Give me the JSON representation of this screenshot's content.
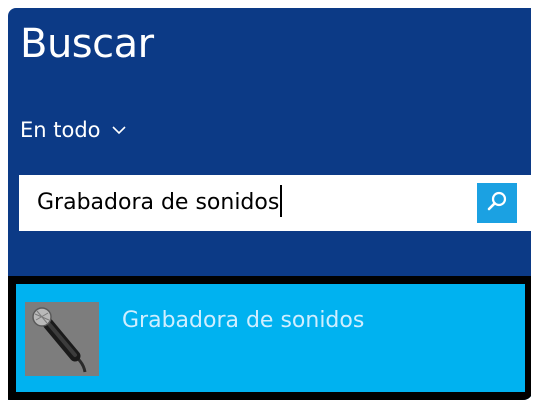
{
  "panel": {
    "title": "Buscar",
    "background_color": "#0c3a86"
  },
  "scope_selector": {
    "label": "En todo",
    "icon": "chevron-down-icon"
  },
  "search": {
    "value": "Grabadora de sonidos",
    "button_icon": "search-icon",
    "button_color": "#1ba1e2"
  },
  "results": {
    "items": [
      {
        "label": "Grabadora de sonidos",
        "icon": "microphone-icon",
        "highlight_color": "#00b2f0"
      }
    ]
  }
}
